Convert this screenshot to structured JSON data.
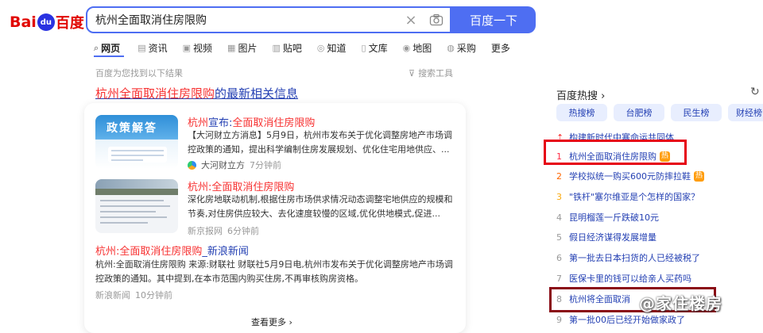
{
  "logo": {
    "left": "Bai",
    "paw": "du",
    "right": "百度"
  },
  "search": {
    "query": "杭州全面取消住房限购",
    "button": "百度一下"
  },
  "tabs": [
    {
      "label": "网页",
      "icon": "search-icon"
    },
    {
      "label": "资讯",
      "icon": "news-icon"
    },
    {
      "label": "视频",
      "icon": "video-icon"
    },
    {
      "label": "图片",
      "icon": "image-icon"
    },
    {
      "label": "贴吧",
      "icon": "tieba-icon"
    },
    {
      "label": "知道",
      "icon": "zhidao-icon"
    },
    {
      "label": "文库",
      "icon": "wenku-icon"
    },
    {
      "label": "地图",
      "icon": "map-icon"
    },
    {
      "label": "采购",
      "icon": "purchase-icon"
    },
    {
      "label": "更多",
      "icon": ""
    }
  ],
  "found_text": "百度为您找到以下结果",
  "tools_label": "搜索工具",
  "headline": {
    "em": "杭州全面取消住房限购",
    "rest": "的最新相关信息"
  },
  "results": [
    {
      "thumb_text": "政策解答",
      "title_a": "杭州",
      "title_b": "宣布:",
      "title_c": "全面取消住房限购",
      "desc": "【大河财立方消息】5月9日，杭州市发布关于优化调整房地产市场调控政策的通知，提出科学编制住房发展规划、优化住宅用地供应、...",
      "source": "大河财立方",
      "time": "7分钟前"
    },
    {
      "title_a": "杭州:",
      "title_b": "",
      "title_c": "全面取消住房限购",
      "desc": "深化房地联动机制,根据住房市场供求情况动态调整宅地供应的规模和节奏,对住房供应较大、去化速度较慢的区域,优化供地模式,促进...",
      "source": "新京报网",
      "time": "6分钟前"
    },
    {
      "title_em": "杭州:全面取消住房限购",
      "title_rest": "_新浪新闻",
      "desc": "杭州:全面取消住房限购 来源:财联社 财联社5月9日电,杭州市发布关于优化调整房地产市场调控政策的通知。其中提到,在本市范围内购买住房,不再审核购房资格。",
      "source": "新浪新闻",
      "time": "10分钟前"
    }
  ],
  "see_more": "查看更多 ›",
  "hot": {
    "title": "百度热搜 ›",
    "chips": [
      "热搜榜",
      "台肥榜",
      "民生榜",
      "财经榜"
    ],
    "items": [
      {
        "n": "⇡",
        "text": "构建新时代中塞命运共同体"
      },
      {
        "n": "1",
        "text": "杭州全面取消住房限购",
        "badge": "热"
      },
      {
        "n": "2",
        "text": "学校拟统一购买600元防摔拉鞋",
        "badge": "热"
      },
      {
        "n": "3",
        "text": "\"铁杆\"塞尔维亚是个怎样的国家？"
      },
      {
        "n": "4",
        "text": "昆明榴莲一斤跌破10元"
      },
      {
        "n": "5",
        "text": "假日经济谋得发展增量"
      },
      {
        "n": "6",
        "text": "第一批去日本扫货的人已经被税了"
      },
      {
        "n": "7",
        "text": "医保卡里的钱可以给亲人买药吗"
      },
      {
        "n": "8",
        "text": "杭州将全面取消"
      },
      {
        "n": "9",
        "text": "第一批00后已经开始做家政了"
      }
    ]
  },
  "watermark": "@家住楼房"
}
